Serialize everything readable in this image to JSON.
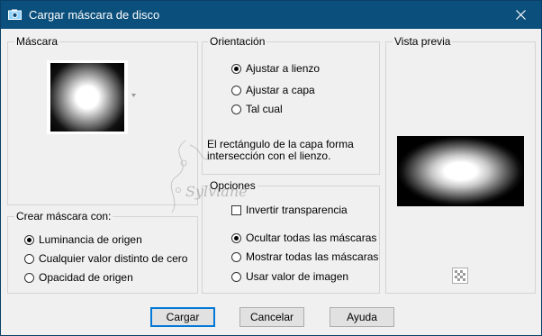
{
  "window": {
    "title": "Cargar máscara de disco"
  },
  "mascara_group": {
    "label": "Máscara"
  },
  "crear_group": {
    "label": "Crear máscara con:",
    "options": [
      {
        "label": "Luminancia de origen",
        "selected": true
      },
      {
        "label": "Cualquier valor distinto de cero",
        "selected": false
      },
      {
        "label": "Opacidad de origen",
        "selected": false
      }
    ]
  },
  "orientacion_group": {
    "label": "Orientación",
    "options": [
      {
        "label": "Ajustar a lienzo",
        "selected": true
      },
      {
        "label": "Ajustar a capa",
        "selected": false
      },
      {
        "label": "Tal cual",
        "selected": false
      }
    ],
    "description_line1": "El rectángulo de la capa forma",
    "description_line2": "intersección con el lienzo."
  },
  "opciones_group": {
    "label": "Opciones",
    "invert_label": "Invertir transparencia",
    "invert_checked": false,
    "options": [
      {
        "label": "Ocultar todas las máscaras",
        "selected": true
      },
      {
        "label": "Mostrar todas las máscaras",
        "selected": false
      },
      {
        "label": "Usar valor de imagen",
        "selected": false
      }
    ]
  },
  "preview_group": {
    "label": "Vista previa"
  },
  "buttons": {
    "ok": "Cargar",
    "cancel": "Cancelar",
    "help": "Ayuda"
  },
  "watermark": "Sylviane"
}
